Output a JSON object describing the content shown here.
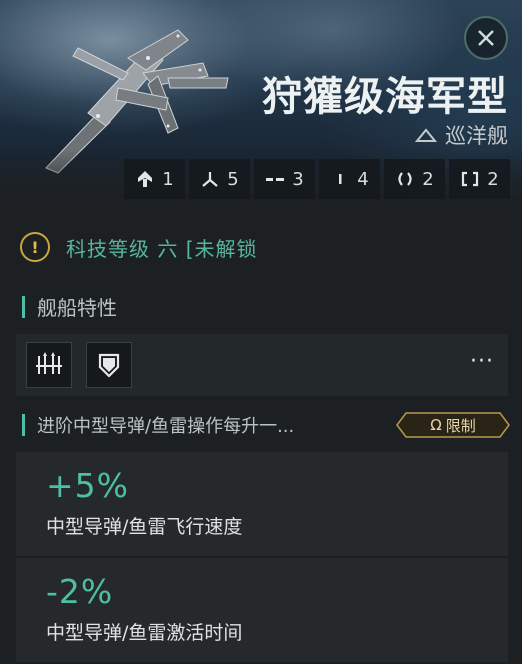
{
  "ship": {
    "name": "狩獾级海军型",
    "class": "巡洋舰",
    "slots": [
      {
        "icon": "high-slot-icon",
        "count": "1"
      },
      {
        "icon": "turret-icon",
        "count": "5"
      },
      {
        "icon": "mid-slot-icon",
        "count": "3"
      },
      {
        "icon": "low-slot-icon",
        "count": "4"
      },
      {
        "icon": "rig-icon",
        "count": "2"
      },
      {
        "icon": "subsystem-icon",
        "count": "2"
      }
    ]
  },
  "tech": {
    "text": "科技等级 六 [未解锁"
  },
  "traits": {
    "title": "舰船特性",
    "more": "···"
  },
  "bonus": {
    "header": "进阶中型导弹/鱼雷操作每升一...",
    "badge_symbol": "Ω",
    "badge_label": "限制",
    "items": [
      {
        "value": "+5%",
        "desc": "中型导弹/鱼雷飞行速度"
      },
      {
        "value": "-2%",
        "desc": "中型导弹/鱼雷激活时间"
      }
    ]
  },
  "colors": {
    "accent": "#4dbfa6",
    "warning": "#c9a640",
    "badge": "#e7d6a8"
  }
}
